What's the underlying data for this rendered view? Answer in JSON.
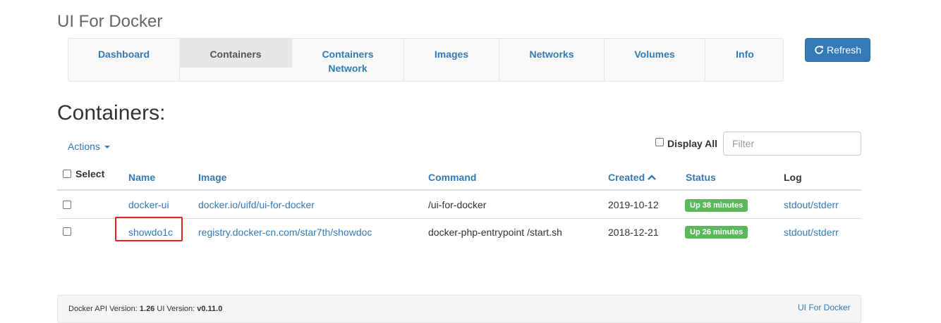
{
  "app": {
    "title": "UI For Docker"
  },
  "nav": {
    "items": [
      {
        "label": "Dashboard"
      },
      {
        "label": "Containers",
        "active": true
      },
      {
        "label": "Containers Network"
      },
      {
        "label": "Images"
      },
      {
        "label": "Networks"
      },
      {
        "label": "Volumes"
      },
      {
        "label": "Info"
      }
    ]
  },
  "toolbar": {
    "refresh_label": "Refresh",
    "refresh_icon": "refresh-icon"
  },
  "page": {
    "heading": "Containers:"
  },
  "controls": {
    "actions_label": "Actions",
    "display_all_label": "Display All",
    "filter_placeholder": "Filter"
  },
  "table": {
    "headers": {
      "select": "Select",
      "name": "Name",
      "image": "Image",
      "command": "Command",
      "created": "Created",
      "status": "Status",
      "log": "Log"
    },
    "rows": [
      {
        "name": "docker-ui",
        "image": "docker.io/uifd/ui-for-docker",
        "command": "/ui-for-docker",
        "created": "2019-10-12",
        "status": "Up 38 minutes",
        "log": "stdout/stderr"
      },
      {
        "name": "showdo1c",
        "image": "registry.docker-cn.com/star7th/showdoc",
        "command": "docker-php-entrypoint /start.sh",
        "created": "2018-12-21",
        "status": "Up 26 minutes",
        "log": "stdout/stderr"
      }
    ]
  },
  "footer": {
    "api_label": "Docker API Version:",
    "api_version": "1.26",
    "ui_label": "UI Version:",
    "ui_version": "v0.11.0",
    "link": "UI For Docker"
  },
  "colors": {
    "primary": "#337ab7",
    "success": "#5cb85c",
    "highlight": "#e3222a"
  }
}
